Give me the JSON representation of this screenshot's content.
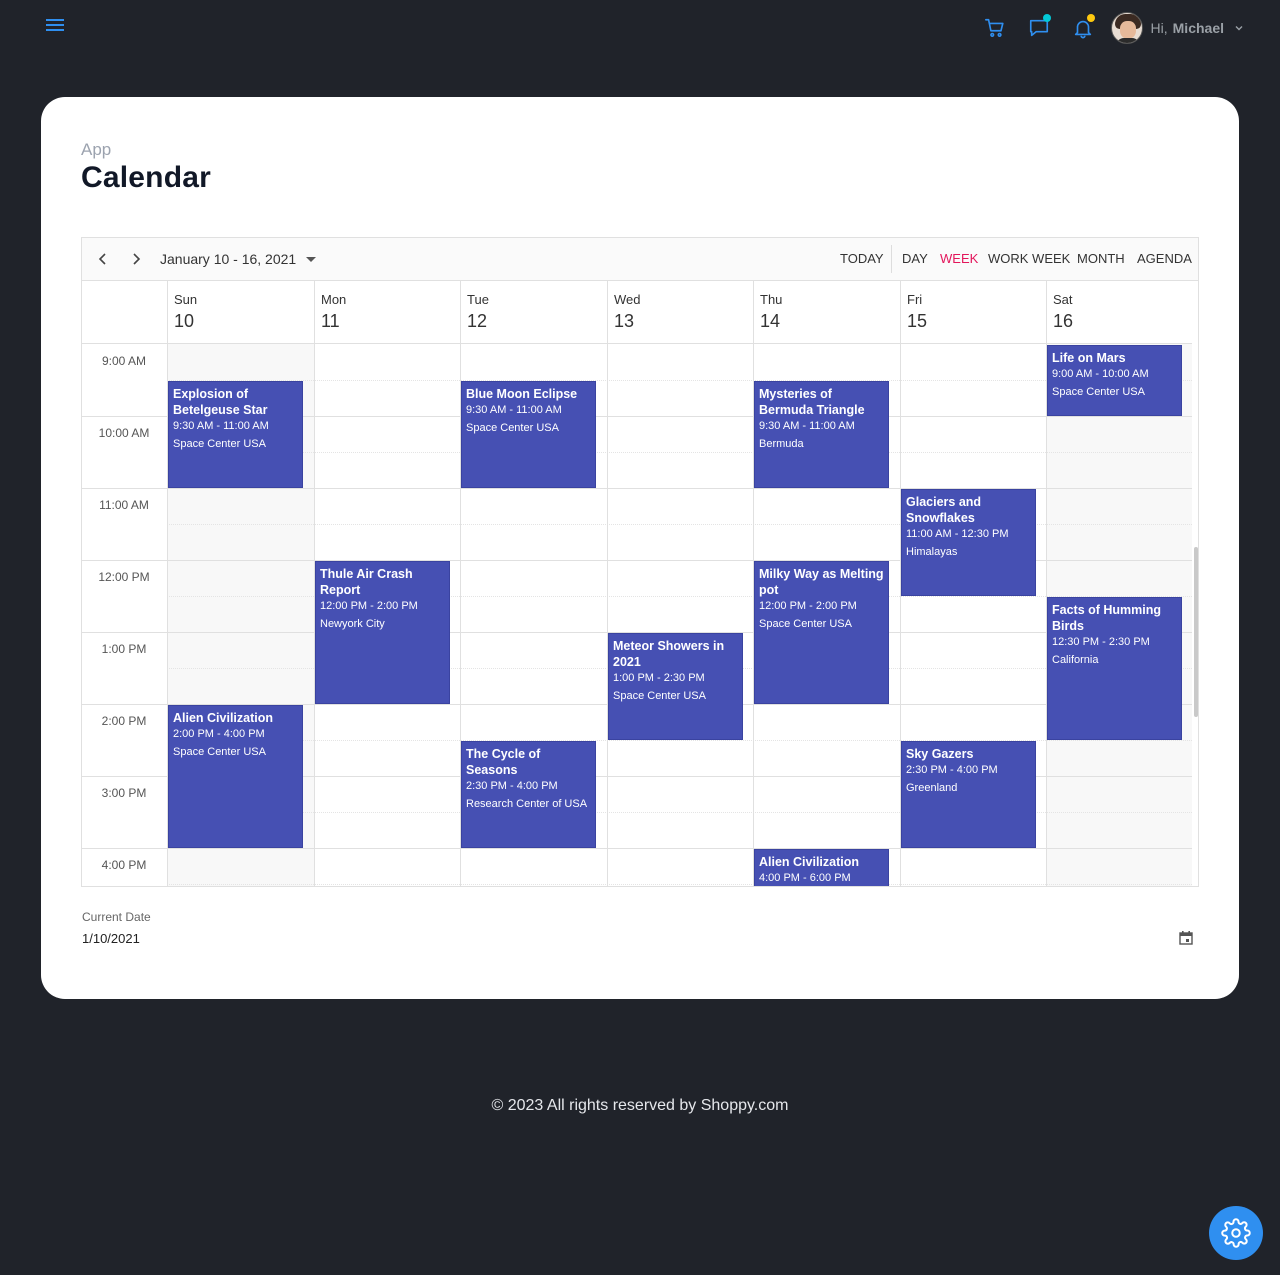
{
  "nav": {
    "menu_icon": "hamburger-icon",
    "icons": [
      "cart-icon",
      "chat-icon",
      "bell-icon"
    ],
    "chat_dot_color": "#03c9d7",
    "bell_dot_color": "#fec90f",
    "greeting": "Hi,",
    "user_name": "Michael"
  },
  "page": {
    "breadcrumb": "App",
    "title": "Calendar"
  },
  "toolbar": {
    "date_range": "January 10 - 16, 2021",
    "today": "TODAY",
    "views": [
      "DAY",
      "WEEK",
      "WORK WEEK",
      "MONTH",
      "AGENDA"
    ],
    "active_view": "WEEK",
    "active_color": "#e3165b"
  },
  "days": [
    {
      "name": "Sun",
      "num": "10"
    },
    {
      "name": "Mon",
      "num": "11"
    },
    {
      "name": "Tue",
      "num": "12"
    },
    {
      "name": "Wed",
      "num": "13"
    },
    {
      "name": "Thu",
      "num": "14"
    },
    {
      "name": "Fri",
      "num": "15"
    },
    {
      "name": "Sat",
      "num": "16"
    }
  ],
  "times": [
    "9:00 AM",
    "10:00 AM",
    "11:00 AM",
    "12:00 PM",
    "1:00 PM",
    "2:00 PM",
    "3:00 PM",
    "4:00 PM"
  ],
  "event_color": "#4650b3",
  "events": [
    {
      "day": 0,
      "start": 9.5,
      "end": 11,
      "title": "Explosion of Betelgeuse Star",
      "time": "9:30 AM - 11:00 AM",
      "location": "Space Center USA"
    },
    {
      "day": 0,
      "start": 14,
      "end": 16,
      "title": "Alien Civilization",
      "time": "2:00 PM - 4:00 PM",
      "location": "Space Center USA"
    },
    {
      "day": 1,
      "start": 12,
      "end": 14,
      "title": "Thule Air Crash Report",
      "time": "12:00 PM - 2:00 PM",
      "location": "Newyork City"
    },
    {
      "day": 2,
      "start": 9.5,
      "end": 11,
      "title": "Blue Moon Eclipse",
      "time": "9:30 AM - 11:00 AM",
      "location": "Space Center USA"
    },
    {
      "day": 2,
      "start": 14.5,
      "end": 16,
      "title": "The Cycle of Seasons",
      "time": "2:30 PM - 4:00 PM",
      "location": "Research Center of USA"
    },
    {
      "day": 3,
      "start": 13,
      "end": 14.5,
      "title": "Meteor Showers in 2021",
      "time": "1:00 PM - 2:30 PM",
      "location": "Space Center USA"
    },
    {
      "day": 4,
      "start": 9.5,
      "end": 11,
      "title": "Mysteries of Bermuda Triangle",
      "time": "9:30 AM - 11:00 AM",
      "location": "Bermuda"
    },
    {
      "day": 4,
      "start": 12,
      "end": 14,
      "title": "Milky Way as Melting pot",
      "time": "12:00 PM - 2:00 PM",
      "location": "Space Center USA"
    },
    {
      "day": 4,
      "start": 16,
      "end": 18,
      "title": "Alien Civilization",
      "time": "4:00 PM - 6:00 PM",
      "location": ""
    },
    {
      "day": 5,
      "start": 11,
      "end": 12.5,
      "title": "Glaciers and Snowflakes",
      "time": "11:00 AM - 12:30 PM",
      "location": "Himalayas"
    },
    {
      "day": 5,
      "start": 14.5,
      "end": 16,
      "title": "Sky Gazers",
      "time": "2:30 PM - 4:00 PM",
      "location": "Greenland"
    },
    {
      "day": 6,
      "start": 9,
      "end": 10,
      "title": "Life on Mars",
      "time": "9:00 AM - 10:00 AM",
      "location": "Space Center USA"
    },
    {
      "day": 6,
      "start": 12.5,
      "end": 14.5,
      "title": "Facts of Humming Birds",
      "time": "12:30 PM - 2:30 PM",
      "location": "California"
    }
  ],
  "current_date": {
    "label": "Current Date",
    "value": "1/10/2021"
  },
  "footer": "© 2023 All rights reserved by Shoppy.com",
  "accent_color": "#2f8ff0"
}
